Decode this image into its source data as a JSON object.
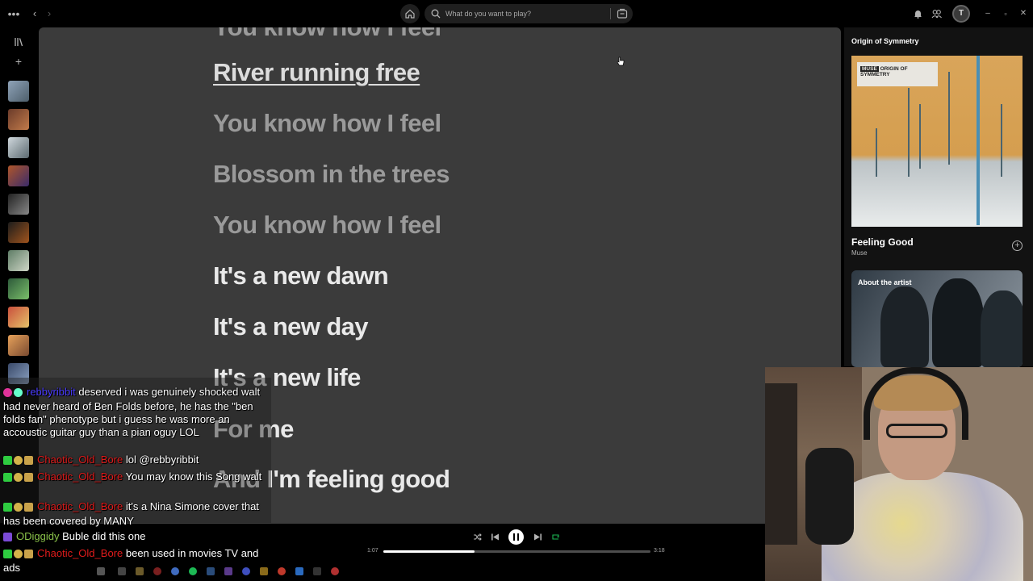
{
  "search": {
    "placeholder": "What do you want to play?"
  },
  "lyrics": {
    "partial_top": "You know how I feel",
    "lines": [
      {
        "text": "River running free",
        "state": "current"
      },
      {
        "text": "You know how I feel",
        "state": "past"
      },
      {
        "text": "Blossom in the trees",
        "state": "past"
      },
      {
        "text": "You know how I feel",
        "state": "past"
      },
      {
        "text": "It's a new dawn",
        "state": "upcoming"
      },
      {
        "text": "It's a new day",
        "state": "upcoming"
      },
      {
        "text": "It's a new life",
        "state": "upcoming"
      },
      {
        "text": "For me",
        "state": "upcoming"
      },
      {
        "text": "And I'm feeling good",
        "state": "upcoming"
      }
    ]
  },
  "now_playing": {
    "album": "Origin of Symmetry",
    "album_cover_text": "ORIGIN OF SYMMETRY",
    "album_cover_brand": "MUSE",
    "title": "Feeling Good",
    "artist": "Muse",
    "about_label": "About the artist"
  },
  "player": {
    "elapsed": "1:07",
    "duration": "3:18",
    "progress_fraction": 0.34
  },
  "chat": [
    {
      "user": "rebbyribbit",
      "user_color": "#4b3cff",
      "text": "deserved i was genuinely shocked walt had never heard of Ben Folds before, he has the \"ben folds fan\" phenotype but i guess he was more an accoustic guitar guy than a pian oguy LOL"
    },
    {
      "user": "Chaotic_Old_Bore",
      "user_color": "#e01b1b",
      "text": "lol @rebbyribbit"
    },
    {
      "user": "Chaotic_Old_Bore",
      "user_color": "#e01b1b",
      "text": "You may know this Song walt"
    },
    {
      "user": "Chaotic_Old_Bore",
      "user_color": "#e01b1b",
      "text": "it's a Nina Simone cover that has been covered by MANY"
    },
    {
      "user": "ODiggidy",
      "user_color": "#8bc34a",
      "text": "Buble did this one"
    },
    {
      "user": "Chaotic_Old_Bore",
      "user_color": "#e01b1b",
      "text": "been used in movies TV and ads"
    }
  ],
  "colors": {
    "lyrics_bg": "#3b3b3b",
    "accent_green": "#1db954"
  },
  "icons": [
    "menu-dots-icon",
    "back-arrow-icon",
    "forward-arrow-icon",
    "home-icon",
    "search-icon",
    "browse-icon",
    "bell-icon",
    "friends-icon",
    "library-icon",
    "plus-icon",
    "shuffle-icon",
    "previous-icon",
    "pause-icon",
    "next-icon",
    "repeat-icon",
    "add-circle-icon"
  ]
}
